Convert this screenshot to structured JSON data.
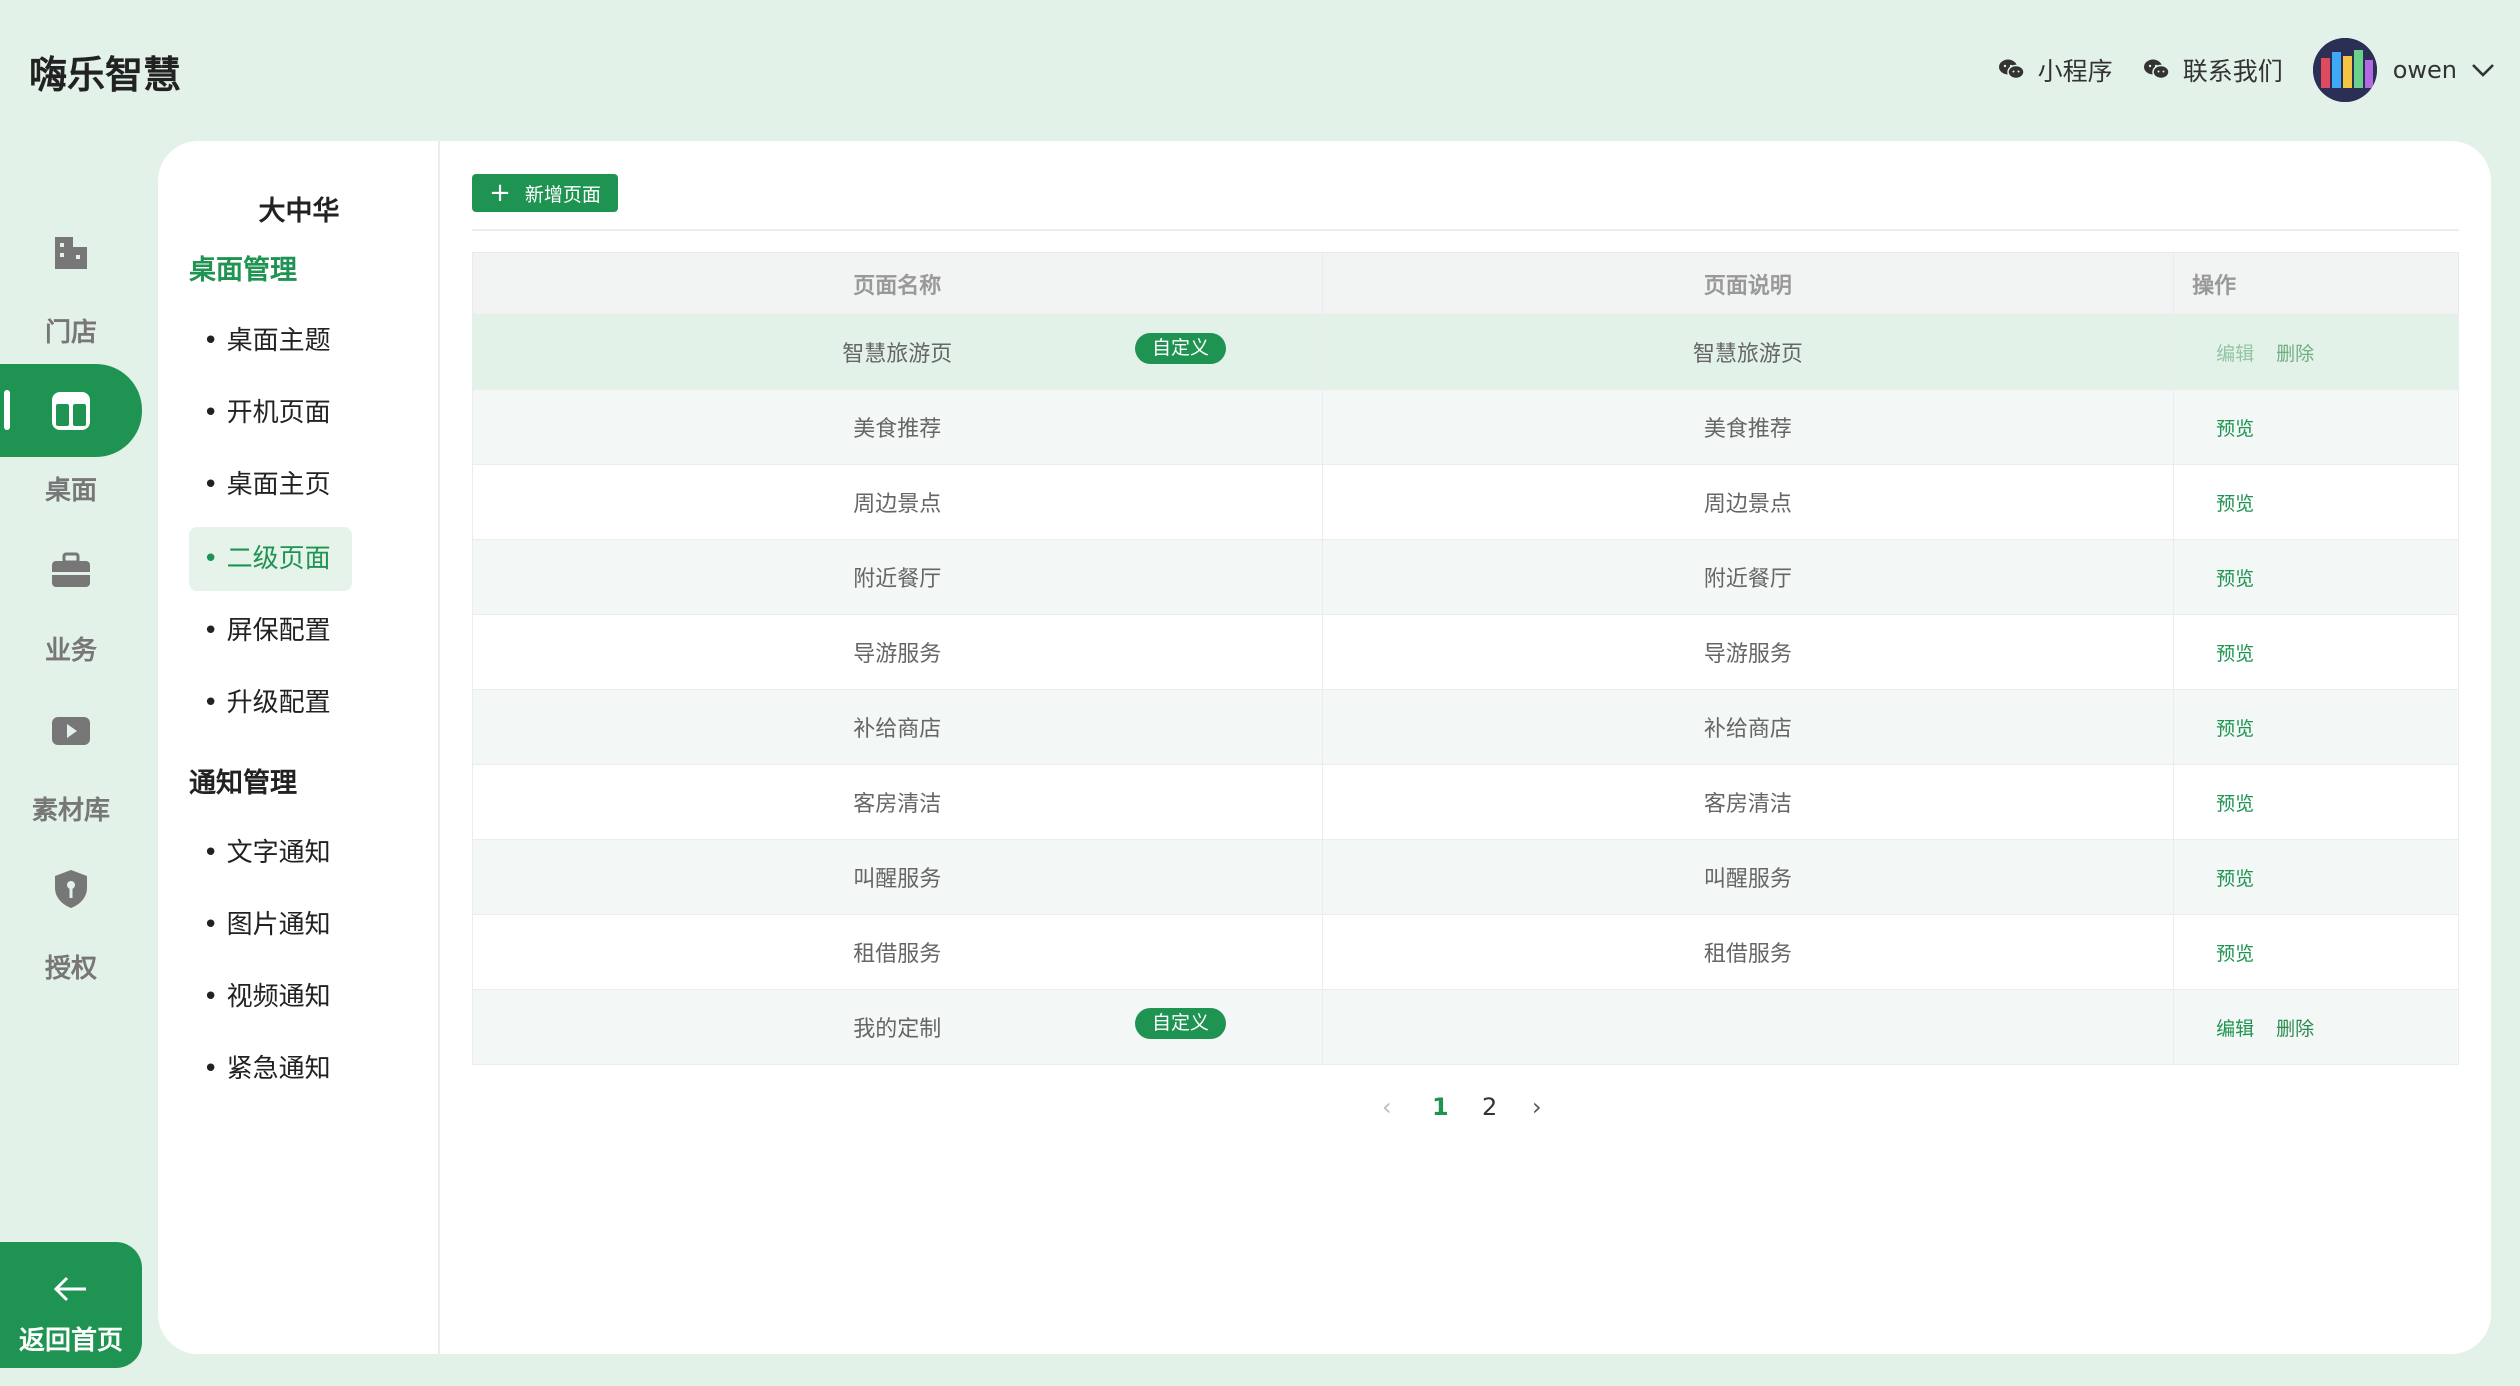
{
  "header": {
    "app_title": "嗨乐智慧",
    "mini_program": "小程序",
    "contact_us": "联系我们",
    "username": "owen"
  },
  "rail": {
    "store": "门店",
    "desktop": "桌面",
    "business": "业务",
    "assets": "素材库",
    "auth": "授权",
    "back_home": "返回首页"
  },
  "subnav": {
    "store_name": "大中华",
    "group1": "桌面管理",
    "group1_items": [
      "• 桌面主题",
      "• 开机页面",
      "• 桌面主页",
      "• 二级页面",
      "• 屏保配置",
      "• 升级配置"
    ],
    "group2": "通知管理",
    "group2_items": [
      "• 文字通知",
      "• 图片通知",
      "• 视频通知",
      "• 紧急通知"
    ]
  },
  "main": {
    "add_button": "新增页面",
    "table": {
      "headers": [
        "页面名称",
        "页面说明",
        "操作"
      ],
      "rows": [
        {
          "name": "智慧旅游页",
          "desc": "智慧旅游页",
          "tag": "自定义",
          "actions": [
            "编辑",
            "删除"
          ]
        },
        {
          "name": "美食推荐",
          "desc": "美食推荐",
          "tag": "",
          "actions": [
            "预览"
          ]
        },
        {
          "name": "周边景点",
          "desc": "周边景点",
          "tag": "",
          "actions": [
            "预览"
          ]
        },
        {
          "name": "附近餐厅",
          "desc": "附近餐厅",
          "tag": "",
          "actions": [
            "预览"
          ]
        },
        {
          "name": "导游服务",
          "desc": "导游服务",
          "tag": "",
          "actions": [
            "预览"
          ]
        },
        {
          "name": "补给商店",
          "desc": "补给商店",
          "tag": "",
          "actions": [
            "预览"
          ]
        },
        {
          "name": "客房清洁",
          "desc": "客房清洁",
          "tag": "",
          "actions": [
            "预览"
          ]
        },
        {
          "name": "叫醒服务",
          "desc": "叫醒服务",
          "tag": "",
          "actions": [
            "预览"
          ]
        },
        {
          "name": "租借服务",
          "desc": "租借服务",
          "tag": "",
          "actions": [
            "预览"
          ]
        },
        {
          "name": "我的定制",
          "desc": "",
          "tag": "自定义",
          "actions": [
            "编辑",
            "删除"
          ]
        }
      ]
    },
    "pagination": {
      "prev": "‹",
      "pages": [
        "1",
        "2"
      ],
      "current": "1",
      "next": "›"
    }
  },
  "colors": {
    "accent": "#1f9452",
    "background": "#e3f2e8",
    "tag_bg": "#1f9452"
  }
}
